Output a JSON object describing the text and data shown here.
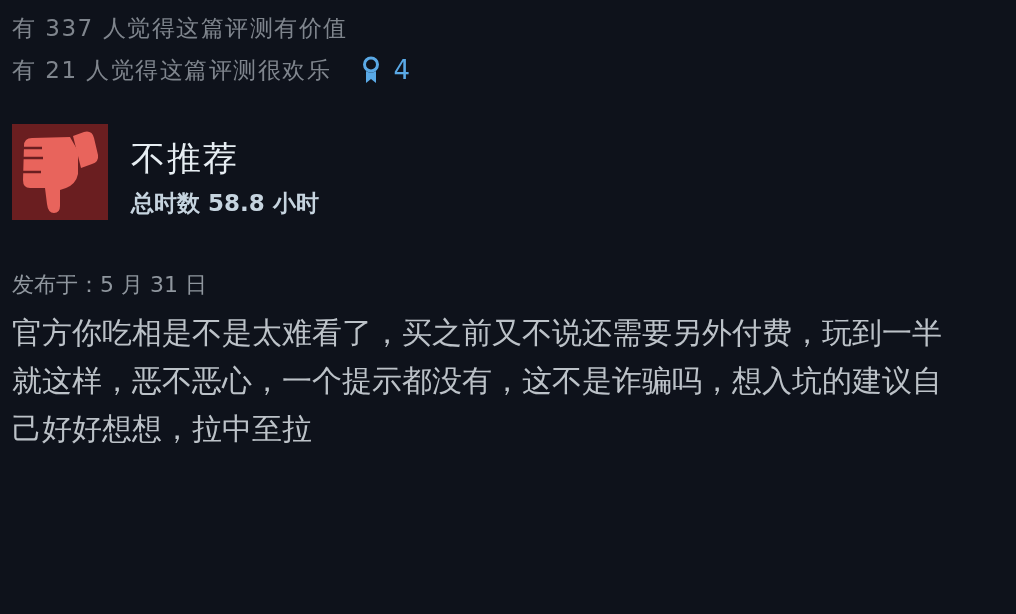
{
  "votes": {
    "helpful": "有 337 人觉得这篇评测有价值",
    "funny": "有 21 人觉得这篇评测很欢乐",
    "award_count": "4"
  },
  "review": {
    "recommended": false,
    "verdict": "不推荐",
    "playtime": "总时数 58.8 小时",
    "posted": "发布于：5 月 31 日",
    "body": "官方你吃相是不是太难看了，买之前又不说还需要另外付费，玩到一半就这样，恶不恶心，一个提示都没有，这不是诈骗吗，想入坑的建议自己好好想想，拉中至拉"
  }
}
